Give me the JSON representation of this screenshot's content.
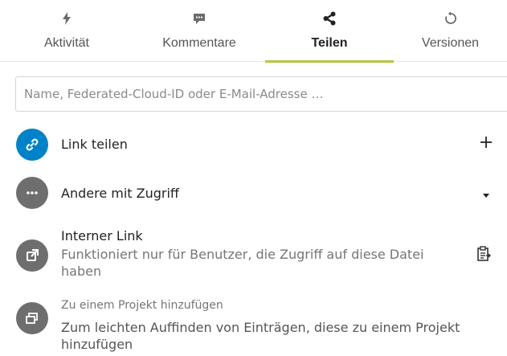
{
  "tabs": [
    {
      "label": "Aktivität",
      "icon": "activity-icon",
      "active": false
    },
    {
      "label": "Kommentare",
      "icon": "comment-icon",
      "active": false
    },
    {
      "label": "Teilen",
      "icon": "share-icon",
      "active": true
    },
    {
      "label": "Versionen",
      "icon": "history-icon",
      "active": false
    }
  ],
  "search": {
    "placeholder": "Name, Federated-Cloud-ID oder E-Mail-Adresse …",
    "value": ""
  },
  "link_share": {
    "title": "Link teilen",
    "icon": "link-icon",
    "action_icon": "plus-icon"
  },
  "others_access": {
    "title": "Andere mit Zugriff",
    "icon": "more-icon",
    "action_icon": "triangle-down-icon"
  },
  "internal_link": {
    "title": "Interner Link",
    "subtitle": "Funktioniert nur für Benutzer, die Zugriff auf diese Datei haben",
    "icon": "external-link-icon",
    "action_icon": "clipboard-icon"
  },
  "project": {
    "title": "Zu einem Projekt hinzufügen",
    "subtitle": "Zum leichten Auffinden von Einträgen, diese zu einem Projekt hinzufügen",
    "icon": "projects-icon"
  },
  "colors": {
    "accent": "#b6c741",
    "link_avatar": "#0082c9",
    "grey_avatar": "#6e6e6e"
  }
}
